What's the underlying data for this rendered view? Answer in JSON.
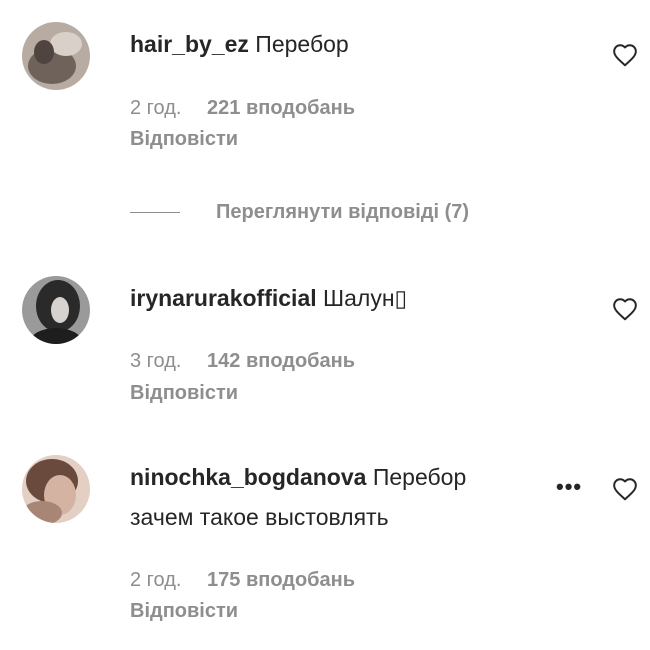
{
  "comments": [
    {
      "username": "hair_by_ez",
      "text": "Перебор",
      "time": "2 год.",
      "likes": "221 вподобань",
      "reply_label": "Відповісти",
      "avatar_color": "#8a7d74"
    },
    {
      "username": "irynarurakofficial",
      "text": "Шалун▯",
      "time": "3 год.",
      "likes": "142 вподобань",
      "reply_label": "Відповісти",
      "avatar_color": "#3a3a3a"
    },
    {
      "username": "ninochka_bogdanova",
      "text": "Перебор",
      "text_line2": "зачем такое выстовлять",
      "time": "2 год.",
      "likes": "175 вподобань",
      "reply_label": "Відповісти",
      "avatar_color": "#c9a99a"
    }
  ],
  "view_replies": {
    "label": "Переглянути відповіді (7)"
  },
  "more_label": "•••",
  "icons": {
    "like": "heart-outline-icon",
    "more": "more-options-icon"
  },
  "colors": {
    "primary_text": "#262626",
    "secondary_text": "#8e8e8e"
  }
}
